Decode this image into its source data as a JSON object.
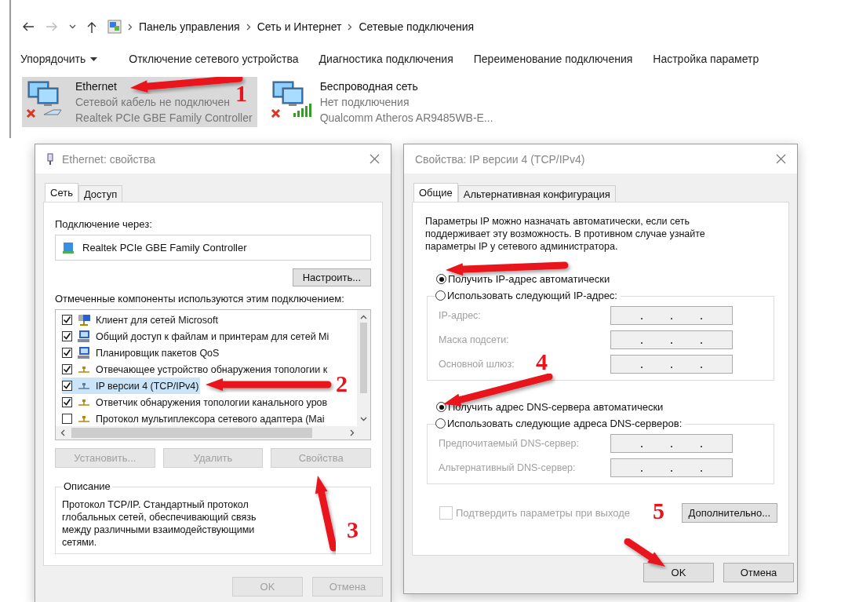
{
  "explorer": {
    "path": [
      "Панель управления",
      "Сеть и Интернет",
      "Сетевые подключения"
    ],
    "toolbar": [
      {
        "label": "Упорядочить",
        "kind": "menu"
      },
      {
        "label": "Отключение сетевого устройства",
        "kind": "action"
      },
      {
        "label": "Диагностика подключения",
        "kind": "action"
      },
      {
        "label": "Переименование подключения",
        "kind": "action"
      },
      {
        "label": "Настройка параметр",
        "kind": "action"
      }
    ],
    "connections": [
      {
        "name": "Ethernet",
        "status": "Сетевой кабель не подключен",
        "adapter": "Realtek PCIe GBE Family Controller",
        "kind": "ethernet",
        "selected": true
      },
      {
        "name": "Беспроводная сеть",
        "status": "Нет подключения",
        "adapter": "Qualcomm Atheros AR9485WB-E...",
        "kind": "wifi",
        "selected": false
      }
    ]
  },
  "ethernet_dialog": {
    "title": "Ethernet: свойства",
    "tabs": [
      {
        "label": "Сеть",
        "selected": true
      },
      {
        "label": "Доступ",
        "selected": false
      }
    ],
    "connect_via_label": "Подключение через:",
    "adapter": "Realtek PCIe GBE Family Controller",
    "configure_button": "Настроить...",
    "components_label": "Отмеченные компоненты используются этим подключением:",
    "components": [
      {
        "label": "Клиент для сетей Microsoft",
        "kind": "client",
        "checked": true,
        "selected": false
      },
      {
        "label": "Общий доступ к файлам и принтерам для сетей Mi",
        "kind": "service",
        "checked": true,
        "selected": false
      },
      {
        "label": "Планировщик пакетов QoS",
        "kind": "service",
        "checked": true,
        "selected": false
      },
      {
        "label": "Отвечающее устройство обнаружения топологии к",
        "kind": "protocol",
        "checked": true,
        "selected": false
      },
      {
        "label": "IP версии 4 (TCP/IPv4)",
        "kind": "protocol",
        "checked": true,
        "selected": true
      },
      {
        "label": "Ответчик обнаружения топологии канального уров",
        "kind": "protocol",
        "checked": true,
        "selected": false
      },
      {
        "label": "Протокол мультиплексора сетевого адаптера (Mai",
        "kind": "protocol",
        "checked": false,
        "selected": false
      }
    ],
    "buttons": [
      {
        "label": "Установить...",
        "disabled": true
      },
      {
        "label": "Удалить",
        "disabled": true
      },
      {
        "label": "Свойства",
        "disabled": true
      }
    ],
    "description": {
      "title": "Описание",
      "text": "Протокол TCP/IP. Стандартный протокол глобальных сетей, обеспечивающий связь между различными взаимодействующими сетями."
    },
    "footer_buttons": [
      {
        "label": "OK",
        "disabled": true
      },
      {
        "label": "Отмена",
        "disabled": true
      }
    ]
  },
  "ipv4_dialog": {
    "title": "Свойства: IP версии 4 (TCP/IPv4)",
    "tabs": [
      {
        "label": "Общие",
        "selected": true
      },
      {
        "label": "Альтернативная конфигурация",
        "selected": false
      }
    ],
    "intro": "Параметры IP можно назначать автоматически, если сеть поддерживает эту возможность. В противном случае узнайте параметры IP у сетевого администратора.",
    "ip_options": [
      {
        "label": "Получить IP-адрес автоматически",
        "selected": true
      },
      {
        "label": "Использовать следующий IP-адрес:",
        "selected": false
      }
    ],
    "ip_fields": [
      {
        "label": "IP-адрес:",
        "disabled": true
      },
      {
        "label": "Маска подсети:",
        "disabled": true
      },
      {
        "label": "Основной шлюз:",
        "disabled": true
      }
    ],
    "dns_options": [
      {
        "label": "Получить адрес DNS-сервера автоматически",
        "selected": true
      },
      {
        "label": "Использовать следующие адреса DNS-серверов:",
        "selected": false
      }
    ],
    "dns_fields": [
      {
        "label": "Предпочитаемый DNS-сервер:",
        "disabled": true
      },
      {
        "label": "Альтернативный DNS-сервер:",
        "disabled": true
      }
    ],
    "validate": {
      "label": "Подтвердить параметры при выходе",
      "checked": false,
      "disabled": true
    },
    "advanced_button": "Дополнительно...",
    "footer_buttons": [
      {
        "label": "OK",
        "disabled": false
      },
      {
        "label": "Отмена",
        "disabled": false
      }
    ]
  },
  "annotations": [
    {
      "label": "1"
    },
    {
      "label": "2"
    },
    {
      "label": "3"
    },
    {
      "label": "4"
    },
    {
      "label": "5"
    }
  ]
}
